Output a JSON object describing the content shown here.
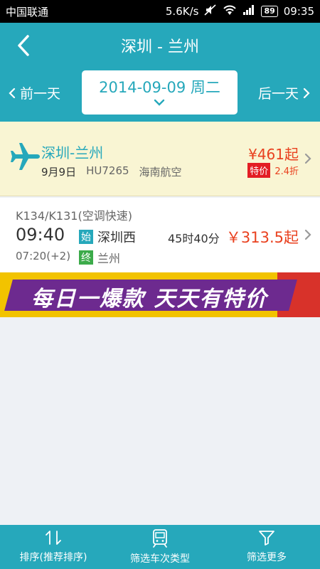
{
  "status_bar": {
    "carrier": "中国联通",
    "speed": "5.6K/s",
    "battery": "89",
    "time": "09:35"
  },
  "header": {
    "title": "深圳 - 兰州"
  },
  "date_bar": {
    "prev_label": "前一天",
    "next_label": "后一天",
    "date": "2014-09-09 周二"
  },
  "flight": {
    "route": "深圳-兰州",
    "date": "9月9日",
    "flight_no": "HU7265",
    "airline": "海南航空",
    "price": "¥461起",
    "tag": "特价",
    "discount": "2.4折"
  },
  "train": {
    "name": "K134/K131(空调快速)",
    "depart_time": "09:40",
    "arrive_time": "07:20(+2)",
    "start_badge": "始",
    "end_badge": "终",
    "from_station": "深圳西",
    "to_station": "兰州",
    "duration": "45时40分",
    "price": "￥313.5起"
  },
  "banner": {
    "text": "每日一爆款 天天有特价"
  },
  "bottom_bar": {
    "items": [
      {
        "label": "排序(推荐排序)",
        "icon": "sort-icon"
      },
      {
        "label": "筛选车次类型",
        "icon": "train-icon"
      },
      {
        "label": "筛选更多",
        "icon": "filter-icon"
      }
    ]
  },
  "colors": {
    "primary": "#26a8bb",
    "price": "#e9411f",
    "flight_bg": "#f9f5d3",
    "page_bg": "#eef1f5"
  }
}
